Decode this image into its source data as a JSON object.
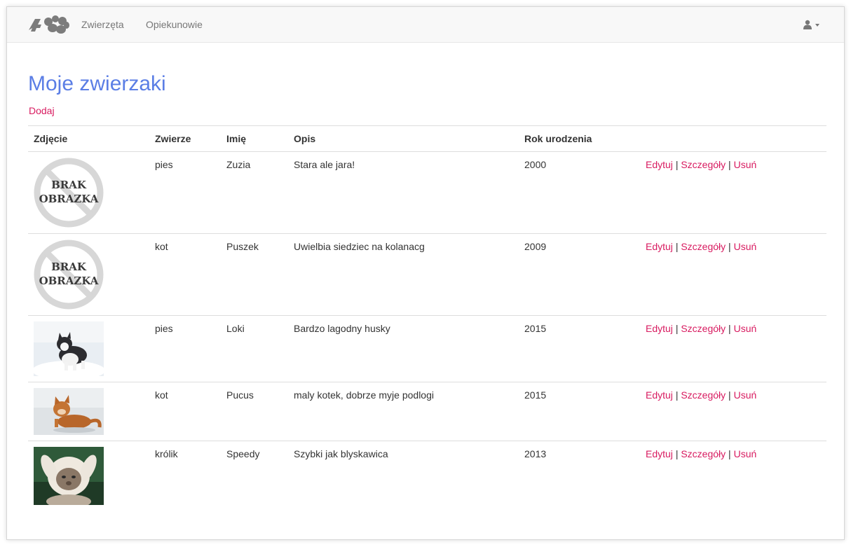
{
  "nav": {
    "links": [
      "Zwierzęta",
      "Opiekunowie"
    ]
  },
  "page": {
    "title": "Moje zwierzaki",
    "add_label": "Dodaj"
  },
  "table": {
    "headers": [
      "Zdjęcie",
      "Zwierze",
      "Imię",
      "Opis",
      "Rok urodzenia",
      ""
    ],
    "rows": [
      {
        "image": "brak-obrazka",
        "image_text": [
          "BRAK",
          "OBRAZKA"
        ],
        "animal": "pies",
        "name": "Zuzia",
        "description": "Stara ale jara!",
        "year": "2000"
      },
      {
        "image": "brak-obrazka",
        "image_text": [
          "BRAK",
          "OBRAZKA"
        ],
        "animal": "kot",
        "name": "Puszek",
        "description": "Uwielbia siedziec na kolanacg",
        "year": "2009"
      },
      {
        "image": "husky-photo",
        "animal": "pies",
        "name": "Loki",
        "description": "Bardzo lagodny husky",
        "year": "2015"
      },
      {
        "image": "kitten-photo",
        "animal": "kot",
        "name": "Pucus",
        "description": "maly kotek, dobrze myje podlogi",
        "year": "2015"
      },
      {
        "image": "bunny-cat-photo",
        "animal": "królik",
        "name": "Speedy",
        "description": "Szybki jak blyskawica",
        "year": "2013"
      }
    ],
    "actions": {
      "edit": "Edytuj",
      "details": "Szczegóły",
      "delete": "Usuń",
      "separator": "|"
    }
  },
  "icons": {
    "brand": "paw-prints-logo",
    "user": "user-icon",
    "dropdown": "caret-down-icon"
  },
  "colors": {
    "accent": "#d81b60",
    "title": "#5b7ee5",
    "navbar_bg": "#f8f8f8",
    "nav_text": "#777777"
  }
}
